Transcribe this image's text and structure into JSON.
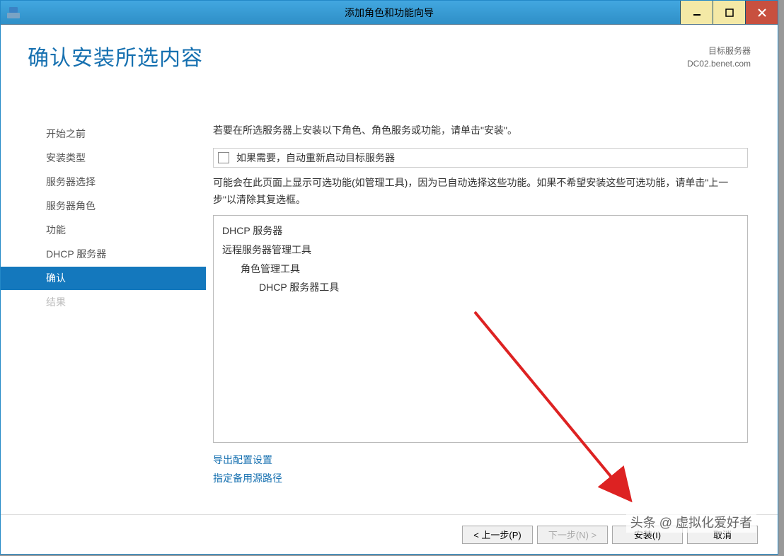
{
  "window": {
    "title": "添加角色和功能向导"
  },
  "header": {
    "heading": "确认安装所选内容",
    "target_label": "目标服务器",
    "target_host": "DC02.benet.com"
  },
  "sidebar": {
    "items": [
      {
        "label": "开始之前"
      },
      {
        "label": "安装类型"
      },
      {
        "label": "服务器选择"
      },
      {
        "label": "服务器角色"
      },
      {
        "label": "功能"
      },
      {
        "label": "DHCP 服务器"
      },
      {
        "label": "确认",
        "active": true
      },
      {
        "label": "结果",
        "disabled": true
      }
    ]
  },
  "main": {
    "intro": "若要在所选服务器上安装以下角色、角色服务或功能，请单击\"安装\"。",
    "checkbox_label": "如果需要，自动重新启动目标服务器",
    "note": "可能会在此页面上显示可选功能(如管理工具)，因为已自动选择这些功能。如果不希望安装这些可选功能，请单击\"上一步\"以清除其复选框。",
    "install_items": {
      "l1a": "DHCP 服务器",
      "l1b": "远程服务器管理工具",
      "l2a": "角色管理工具",
      "l3a": "DHCP 服务器工具"
    },
    "links": {
      "export": "导出配置设置",
      "alt_path": "指定备用源路径"
    }
  },
  "footer": {
    "prev": "< 上一步(P)",
    "next": "下一步(N) >",
    "install": "安装(I)",
    "cancel": "取消"
  },
  "watermark": "头条 @ 虚拟化爱好者"
}
